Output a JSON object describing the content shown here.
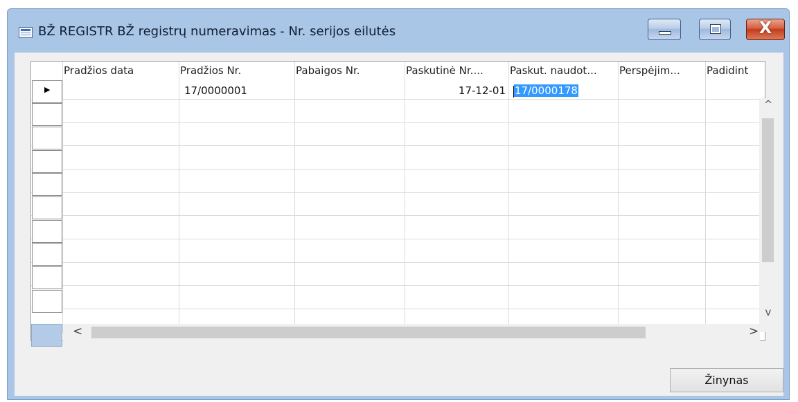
{
  "window": {
    "title": "BŽ REGISTR BŽ registrų numeravimas - Nr. serijos eilutės",
    "icon": "form-window-icon",
    "controls": {
      "minimize": "minimize-icon",
      "maximize": "maximize-icon",
      "close_glyph": "X"
    }
  },
  "grid": {
    "columns": [
      {
        "key": "start_date",
        "label": "Pradžios data"
      },
      {
        "key": "start_no",
        "label": "Pradžios Nr."
      },
      {
        "key": "end_no",
        "label": "Pabaigos Nr."
      },
      {
        "key": "last_date",
        "label": "Paskutinė Nr...."
      },
      {
        "key": "last_used",
        "label": "Paskut. naudot..."
      },
      {
        "key": "warning",
        "label": "Perspėjim..."
      },
      {
        "key": "increment",
        "label": "Padidint"
      }
    ],
    "rows": [
      {
        "indicator": "▶",
        "start_date": "",
        "start_no": "17/0000001",
        "end_no": "",
        "last_date": "17-12-01",
        "last_used": "17/0000178",
        "warning": "",
        "increment": ""
      }
    ],
    "scrollbar_glyphs": {
      "up": "^",
      "down": "v",
      "left": "<",
      "right": ">"
    }
  },
  "footer": {
    "reference_button": "Žinynas"
  }
}
